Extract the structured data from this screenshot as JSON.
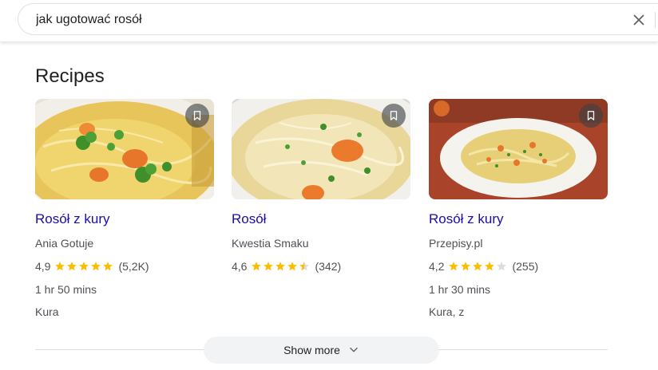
{
  "search": {
    "query": "jak ugotować rosół",
    "clear_icon": "close-icon"
  },
  "section": {
    "title": "Recipes"
  },
  "cards": [
    {
      "title": "Rosół z kury",
      "source": "Ania Gotuje",
      "rating": "4,9",
      "rating_value": 4.9,
      "reviews": "(5,2K)",
      "time": "1 hr 50 mins",
      "ingredients": "Kura"
    },
    {
      "title": "Rosół",
      "source": "Kwestia Smaku",
      "rating": "4,6",
      "rating_value": 4.6,
      "reviews": "(342)",
      "time": "",
      "ingredients": ""
    },
    {
      "title": "Rosół z kury",
      "source": "Przepisy.pl",
      "rating": "4,2",
      "rating_value": 4.2,
      "reviews": "(255)",
      "time": "1 hr 30 mins",
      "ingredients": "Kura, z"
    }
  ],
  "show_more": {
    "label": "Show more",
    "icon": "chevron-down-icon"
  },
  "colors": {
    "link": "#1a0dab",
    "star": "#fbbc04",
    "star_empty": "#dadce0"
  }
}
